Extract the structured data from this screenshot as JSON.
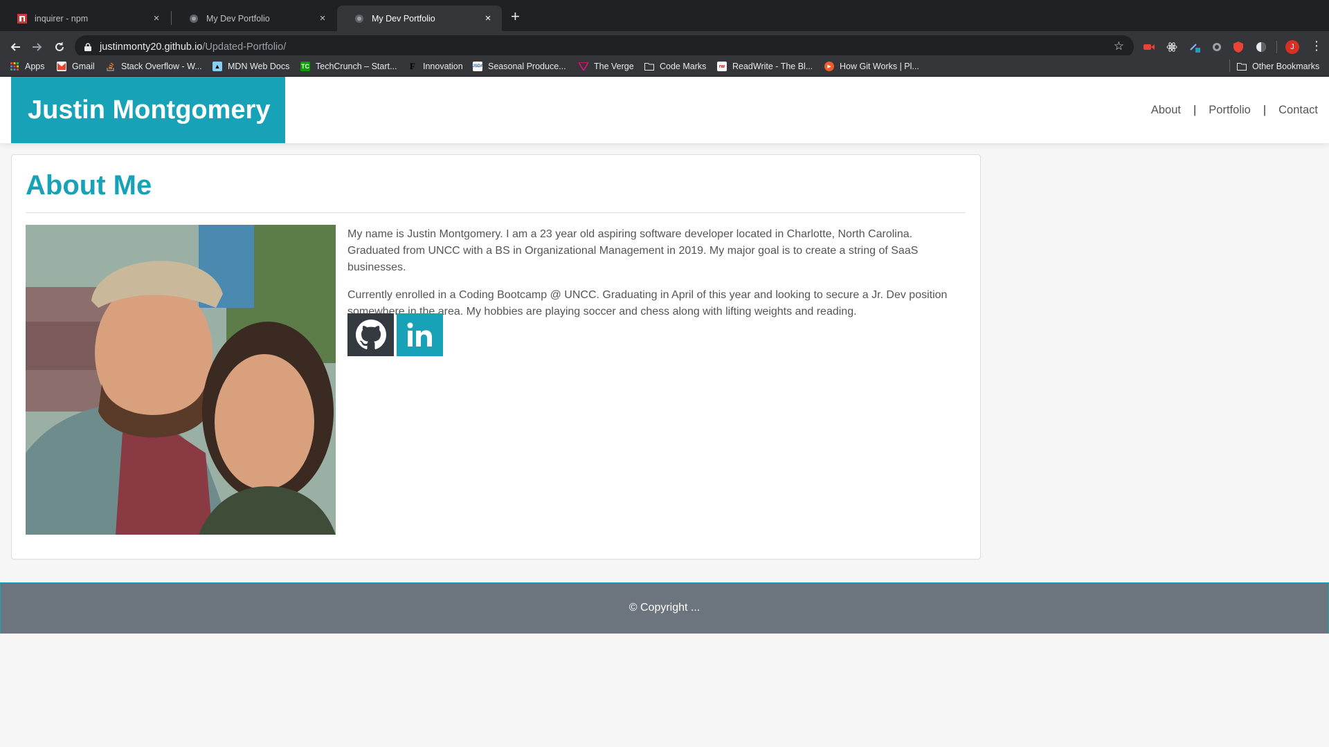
{
  "browser": {
    "tabs": [
      {
        "title": "inquirer - npm",
        "favicon": "npm-icon",
        "active": false
      },
      {
        "title": "My Dev Portfolio",
        "favicon": "globe-icon",
        "active": false
      },
      {
        "title": "My Dev Portfolio",
        "favicon": "globe-icon",
        "active": true
      }
    ],
    "close_glyph": "×",
    "new_tab_glyph": "+",
    "url_host": "justinmonty20.github.io",
    "url_path": "/Updated-Portfolio/",
    "avatar_letter": "J",
    "bookmarks": [
      {
        "label": "Apps",
        "icon": "apps-grid-icon"
      },
      {
        "label": "Gmail",
        "icon": "gmail-icon"
      },
      {
        "label": "Stack Overflow - W...",
        "icon": "stackoverflow-icon"
      },
      {
        "label": "MDN Web Docs",
        "icon": "mdn-icon"
      },
      {
        "label": "TechCrunch – Start...",
        "icon": "techcrunch-icon"
      },
      {
        "label": "Innovation",
        "icon": "forbes-icon"
      },
      {
        "label": "Seasonal Produce...",
        "icon": "usda-icon"
      },
      {
        "label": "The Verge",
        "icon": "verge-icon"
      },
      {
        "label": "Code Marks",
        "icon": "folder-icon"
      },
      {
        "label": "ReadWrite - The Bl...",
        "icon": "readwrite-icon"
      },
      {
        "label": "How Git Works | Pl...",
        "icon": "pluralsight-icon"
      }
    ],
    "other_bookmarks": "Other Bookmarks"
  },
  "header": {
    "brand": "Justin Montgomery",
    "nav": {
      "about": "About",
      "portfolio": "Portfolio",
      "contact": "Contact",
      "separator": "|"
    }
  },
  "about": {
    "heading": "About Me",
    "paragraphs": [
      "My name is Justin Montgomery. I am a 23 year old aspiring software developer located in Charlotte, North Carolina. Graduated from UNCC with a BS in Organizational Management in 2019. My major goal is to create a string of SaaS businesses.",
      "Currently enrolled in a Coding Bootcamp @ UNCC. Graduating in April of this year and looking to secure a Jr. Dev position somewhere in the area. My hobbies are playing soccer and chess along with lifting weights and reading."
    ],
    "socials": [
      {
        "icon": "github-icon",
        "color": "#343a40"
      },
      {
        "icon": "linkedin-icon",
        "color": "#17a2b8"
      }
    ]
  },
  "footer": {
    "text": "© Copyright ..."
  },
  "colors": {
    "accent": "#17a2b8",
    "footer_bg": "#6c757d",
    "page_bg": "#f6f6f6"
  }
}
